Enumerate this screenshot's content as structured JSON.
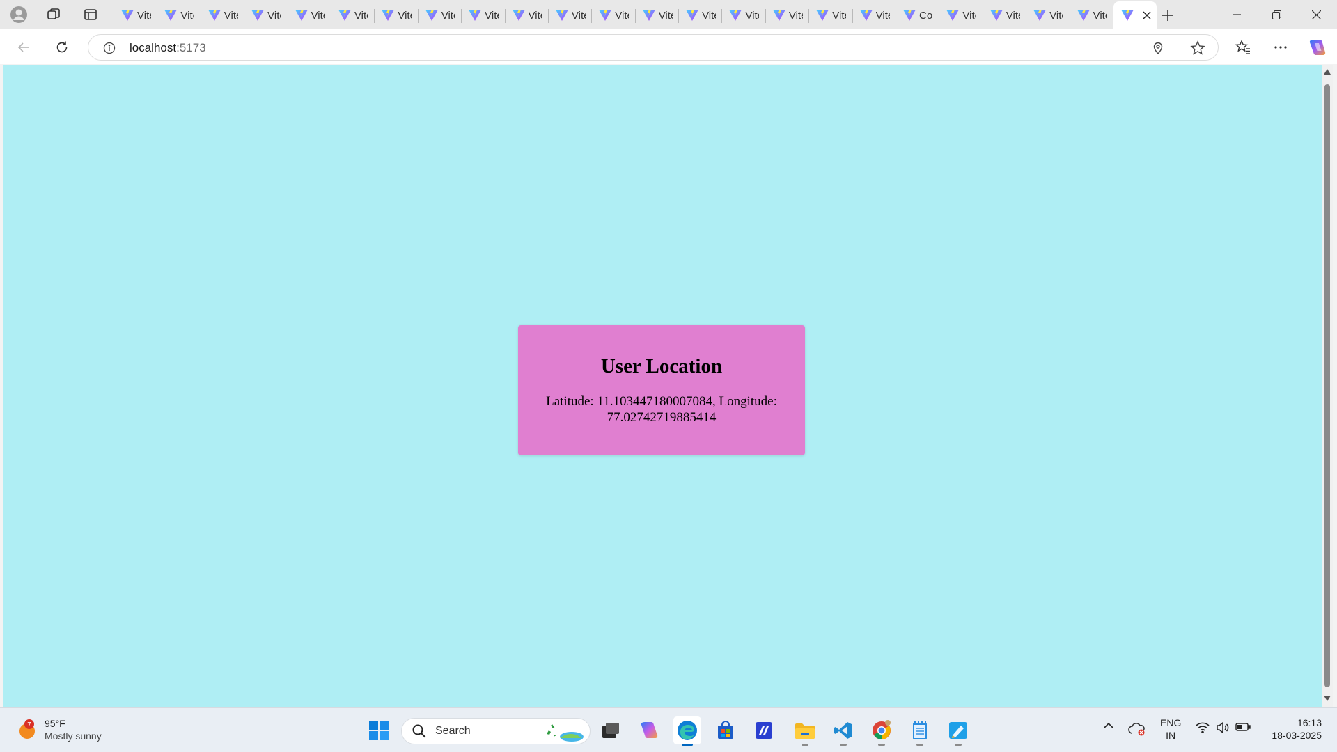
{
  "browser": {
    "tabs": [
      {
        "label": "Vite"
      },
      {
        "label": "Vite"
      },
      {
        "label": "Vite"
      },
      {
        "label": "Vite"
      },
      {
        "label": "Vite"
      },
      {
        "label": "Vite"
      },
      {
        "label": "Vite"
      },
      {
        "label": "Vite"
      },
      {
        "label": "Vite"
      },
      {
        "label": "Vite"
      },
      {
        "label": "Vite"
      },
      {
        "label": "Vite"
      },
      {
        "label": "Vite"
      },
      {
        "label": "Vite"
      },
      {
        "label": "Vite"
      },
      {
        "label": "Vite"
      },
      {
        "label": "Vite"
      },
      {
        "label": "Vite"
      },
      {
        "label": "Co"
      },
      {
        "label": "Vite"
      },
      {
        "label": "Vite"
      },
      {
        "label": "Vite"
      },
      {
        "label": "Vite"
      }
    ],
    "address": {
      "host": "localhost",
      "port": ":5173"
    }
  },
  "page": {
    "background": "#afeef4",
    "card_color": "#e07fd0",
    "title": "User Location",
    "location_text": "Latitude: 11.103447180007084, Longitude: 77.02742719885414"
  },
  "taskbar": {
    "weather": {
      "temp": "95°F",
      "condition": "Mostly sunny",
      "badge": "7"
    },
    "search_label": "Search",
    "language": {
      "line1": "ENG",
      "line2": "IN"
    },
    "clock": {
      "time": "16:13",
      "date": "18-03-2025"
    }
  }
}
